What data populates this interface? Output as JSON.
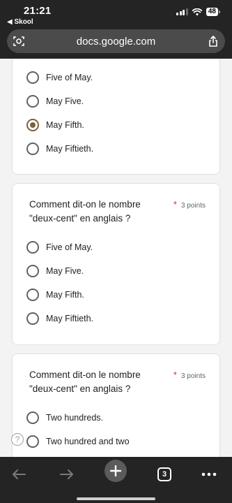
{
  "status_bar": {
    "time": "21:21",
    "back_app": "◀ Skool",
    "battery": "48"
  },
  "browser": {
    "url": "docs.google.com",
    "tab_count": "3"
  },
  "cards": [
    {
      "options": [
        {
          "label": "Five of May.",
          "checked": false
        },
        {
          "label": "May Five.",
          "checked": false
        },
        {
          "label": "May Fifth.",
          "checked": true
        },
        {
          "label": "May Fiftieth.",
          "checked": false
        }
      ]
    },
    {
      "question_line1": "Comment dit-on le nombre",
      "question_line2": "\"deux-cent\" en anglais ?",
      "required_mark": "*",
      "points": "3 points",
      "options": [
        {
          "label": "Five of May.",
          "checked": false
        },
        {
          "label": "May Five.",
          "checked": false
        },
        {
          "label": "May Fifth.",
          "checked": false
        },
        {
          "label": "May Fiftieth.",
          "checked": false
        }
      ]
    },
    {
      "question_line1": "Comment dit-on le nombre",
      "question_line2": "\"deux-cent\" en anglais ?",
      "required_mark": "*",
      "points": "3 points",
      "options": [
        {
          "label": "Two hundreds.",
          "checked": false
        },
        {
          "label": "Two hundred and two",
          "checked": false
        }
      ]
    }
  ],
  "help_glyph": "?"
}
